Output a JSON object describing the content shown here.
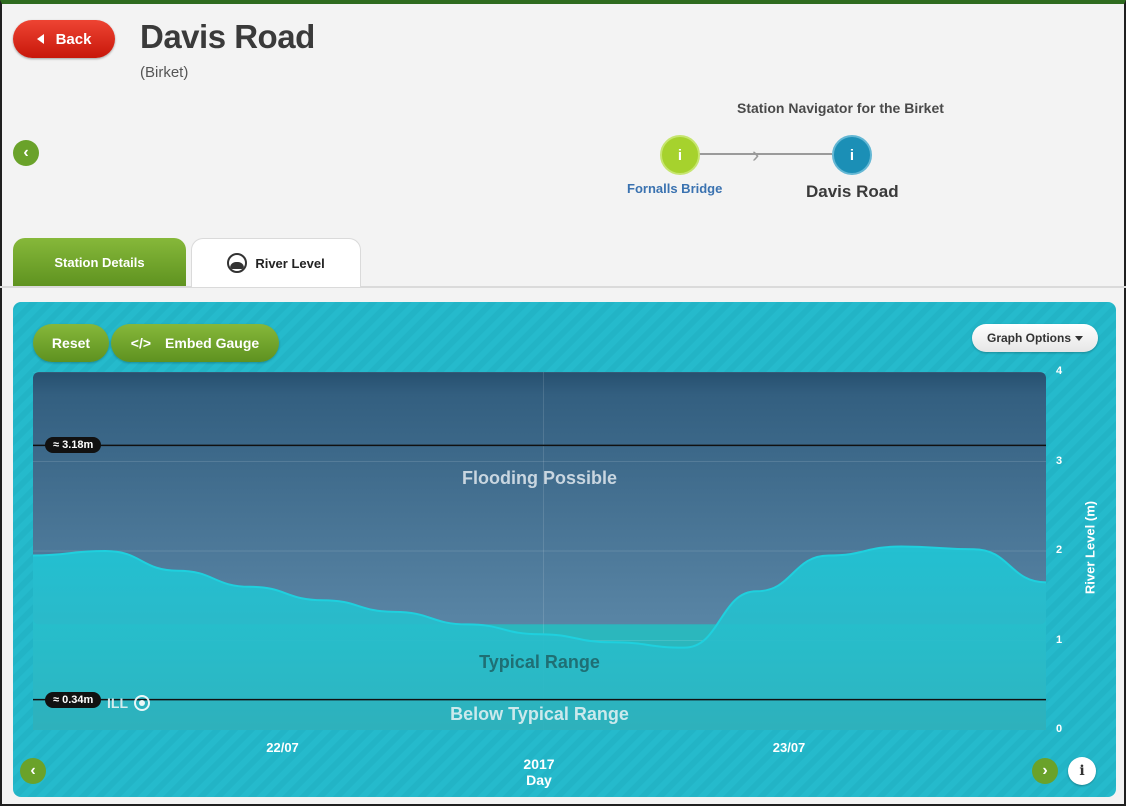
{
  "header": {
    "back_label": "Back",
    "title": "Davis Road",
    "subtitle": "(Birket)"
  },
  "navigator": {
    "title": "Station Navigator for the Birket",
    "previous_station": "Fornalls Bridge",
    "current_station": "Davis Road",
    "node_icon": "i"
  },
  "tabs": [
    {
      "label": "Station Details",
      "active": false
    },
    {
      "label": "River Level",
      "active": true,
      "icon": "river-icon"
    }
  ],
  "toolbar": {
    "reset_label": "Reset",
    "embed_label": "Embed Gauge",
    "embed_icon": "</>",
    "graph_options_label": "Graph Options"
  },
  "logo_text": "ILL",
  "colors": {
    "panel": "#22b4c6",
    "flooding_zone": "#3c6a8f",
    "typical_zone": "#2bb7bd",
    "below_zone": "#238c8c",
    "level_area": "#21c2d2",
    "green_button": "#6aa22a",
    "back_button": "#d9230f"
  },
  "chart_data": {
    "type": "area",
    "x": [
      "21/07 12:00",
      "21/07 18:00",
      "22/07 00:00",
      "22/07 06:00",
      "22/07 12:00",
      "22/07 18:00",
      "23/07 00:00",
      "23/07 06:00",
      "23/07 09:00",
      "23/07 12:00",
      "23/07 15:00",
      "23/07 18:00",
      "23/07 21:00",
      "24/07 00:00",
      "24/07 06:00"
    ],
    "series": [
      {
        "values": [
          1.95,
          2.0,
          1.78,
          1.6,
          1.45,
          1.32,
          1.18,
          1.07,
          0.98,
          0.92,
          1.55,
          1.95,
          2.05,
          2.02,
          1.65
        ]
      }
    ],
    "xticks": [
      "22/07",
      "23/07"
    ],
    "xlabel_year": "2017",
    "xlabel": "Day",
    "ylabel": "River Level (m)",
    "yticks": [
      "0",
      "1",
      "2",
      "3",
      "4"
    ],
    "ylim": [
      0,
      4
    ],
    "zones": [
      {
        "label": "Flooding Possible",
        "from": 1.18,
        "to": 4
      },
      {
        "label": "Typical Range",
        "from": 0.34,
        "to": 1.18
      },
      {
        "label": "Below Typical Range",
        "from": 0,
        "to": 0.34
      }
    ],
    "thresholds": [
      {
        "label": "≈ 3.18m",
        "value": 3.18
      },
      {
        "label": "≈ 0.34m",
        "value": 0.34
      }
    ]
  }
}
